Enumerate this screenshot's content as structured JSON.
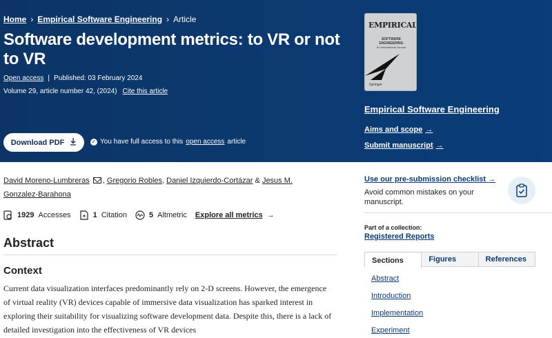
{
  "breadcrumb": {
    "home": "Home",
    "journal": "Empirical Software Engineering",
    "current": "Article"
  },
  "article": {
    "title": "Software development metrics: to VR or not to VR",
    "open_access": "Open access",
    "published": "Published: 03 February 2024",
    "volume_info": "Volume 29, article number 42, (2024)",
    "cite_link": "Cite this article",
    "download_label": "Download PDF",
    "access_prefix": "You have full access to this",
    "access_link": "open access",
    "access_suffix": "article"
  },
  "journal": {
    "cover_title": "EMPIRICAL",
    "cover_sub1": "SOFTWARE",
    "cover_sub2": "ENGINEERING",
    "cover_sub3": "An International Journal",
    "cover_foot": "Springer",
    "name": "Empirical Software Engineering",
    "aims_label": "Aims and scope",
    "submit_label": "Submit manuscript",
    "arrow": "→"
  },
  "authors": {
    "list": [
      "David Moreno-Lumbreras",
      "Gregorio Robles",
      "Daniel Izquierdo-Cortázar",
      "Jesus M. Gonzalez-Barahona"
    ],
    "sep_comma": ",",
    "sep_amp": "&"
  },
  "metrics": {
    "accesses_num": "1929",
    "accesses_label": "Accesses",
    "citations_num": "1",
    "citations_label": "Citation",
    "altmetric_num": "5",
    "altmetric_label": "Altmetric",
    "explore_label": "Explore all metrics",
    "explore_arrow": "→"
  },
  "abstract": {
    "heading": "Abstract",
    "context_heading": "Context",
    "text": "Current data visualization interfaces predominantly rely on 2-D screens. However, the emergence of virtual reality (VR) devices capable of immersive data visualization has sparked interest in exploring their suitability for visualizing software development data. Despite this, there is a lack of detailed investigation into the effectiveness of VR devices"
  },
  "sidebar": {
    "presub_label": "Use our pre-submission checklist",
    "presub_arrow": "→",
    "presub_desc": "Avoid common mistakes on your manuscript.",
    "part_of": "Part of a collection:",
    "collection": "Registered Reports",
    "tabs": [
      "Sections",
      "Figures",
      "References"
    ],
    "sections": [
      "Abstract",
      "Introduction",
      "Implementation",
      "Experiment"
    ]
  },
  "colors": {
    "header_bg": "#0b3a72",
    "link_blue": "#0b3a72"
  }
}
